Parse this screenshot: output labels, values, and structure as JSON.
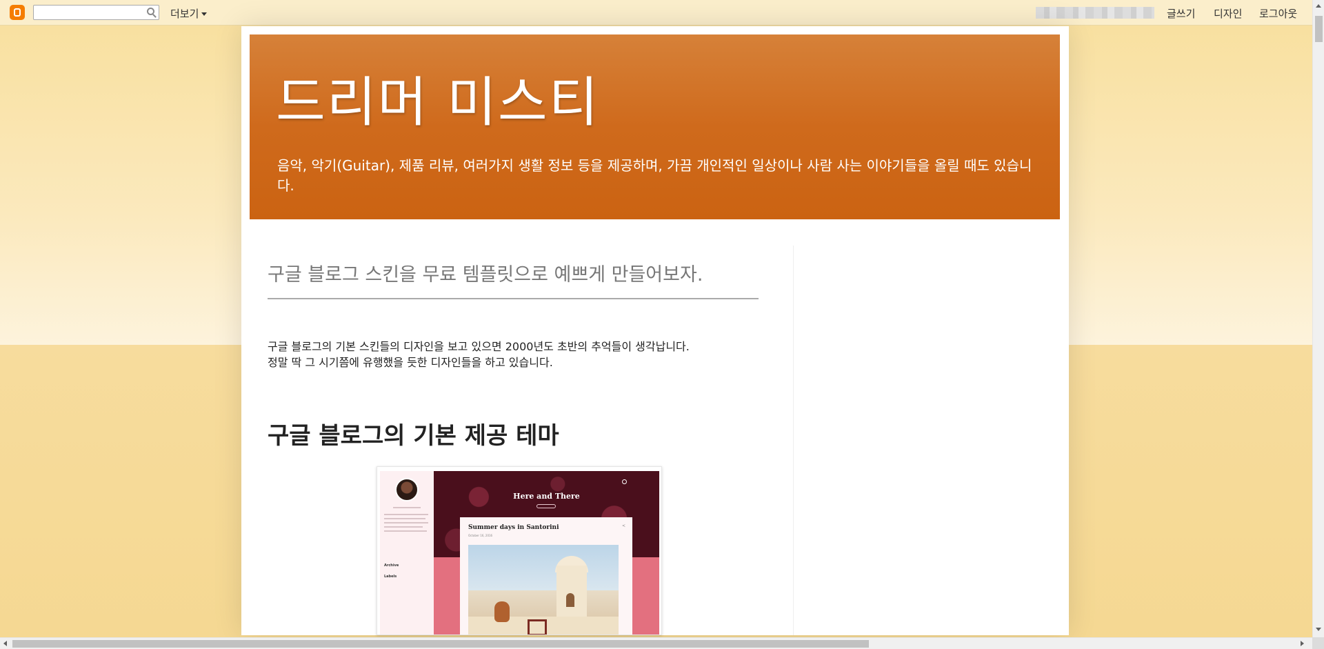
{
  "navbar": {
    "search_placeholder": "",
    "more_label": "더보기",
    "write_label": "글쓰기",
    "design_label": "디자인",
    "logout_label": "로그아웃"
  },
  "header": {
    "title": "드리머 미스티",
    "description": "음악, 악기(Guitar), 제품 리뷰, 여러가지 생활 정보 등을 제공하며, 가끔 개인적인 일상이나 사람 사는 이야기들을 올릴 때도 있습니다."
  },
  "post": {
    "title": "구글 블로그 스킨을 무료 템플릿으로 예쁘게 만들어보자.",
    "body_line1": "구글 블로그의 기본 스킨들의 디자인을 보고 있으면 2000년도 초반의 추억들이 생각납니다.",
    "body_line2": "정말 딱 그 시기쯤에 유행했을 듯한 디자인들을 하고 있습니다.",
    "section_heading": "구글 블로그의 기본 제공 테마"
  },
  "theme_preview": {
    "banner_title": "Here and There",
    "card_title": "Summer days in Santorini",
    "card_date": "October 16, 2016",
    "side_labels": [
      "Archive",
      "Labels"
    ]
  },
  "colors": {
    "header_top": "#d68139",
    "header_bottom": "#cb6312",
    "page_bg": "#f8df9c",
    "blogger_orange": "#f57d00"
  },
  "icons": {
    "blogger_logo": "blogger-logo-icon",
    "search": "search-icon",
    "dropdown": "caret-down-icon"
  }
}
